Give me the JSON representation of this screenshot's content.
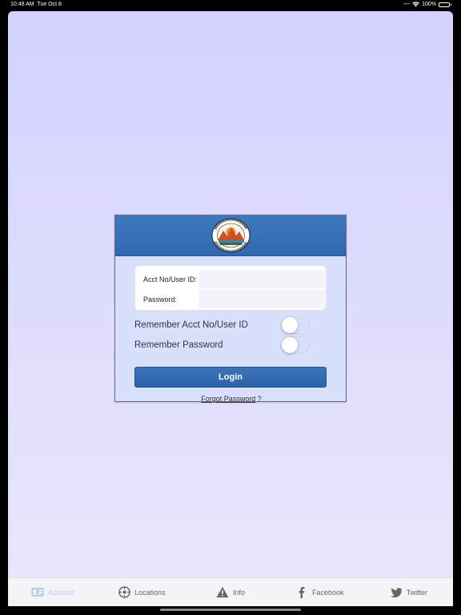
{
  "status": {
    "time": "10:48 AM",
    "date": "Tue Oct 8",
    "battery_percent": "100%",
    "battery_level": 1.0
  },
  "login_form": {
    "account_label": "Acct No/User ID:",
    "account_value": "",
    "password_label": "Password:",
    "password_value": "",
    "remember_account_label": "Remember Acct No/User ID",
    "remember_account_on": false,
    "remember_password_label": "Remember Password",
    "remember_password_on": false,
    "login_label": "Login",
    "forgot_label": "Forgot Password",
    "forgot_suffix": "?"
  },
  "tabs": [
    {
      "label": "Account",
      "icon": "id-card-icon",
      "active": true
    },
    {
      "label": "Locations",
      "icon": "compass-icon",
      "active": false
    },
    {
      "label": "Info",
      "icon": "warning-icon",
      "active": false
    },
    {
      "label": "Facebook",
      "icon": "facebook-icon",
      "active": false
    },
    {
      "label": "Twitter",
      "icon": "twitter-icon",
      "active": false
    }
  ],
  "colors": {
    "header_blue": "#3570b5",
    "background_top": "#d3d2fe",
    "background_bottom": "#e8e8fb",
    "active_tab": "#b6cbe8"
  }
}
